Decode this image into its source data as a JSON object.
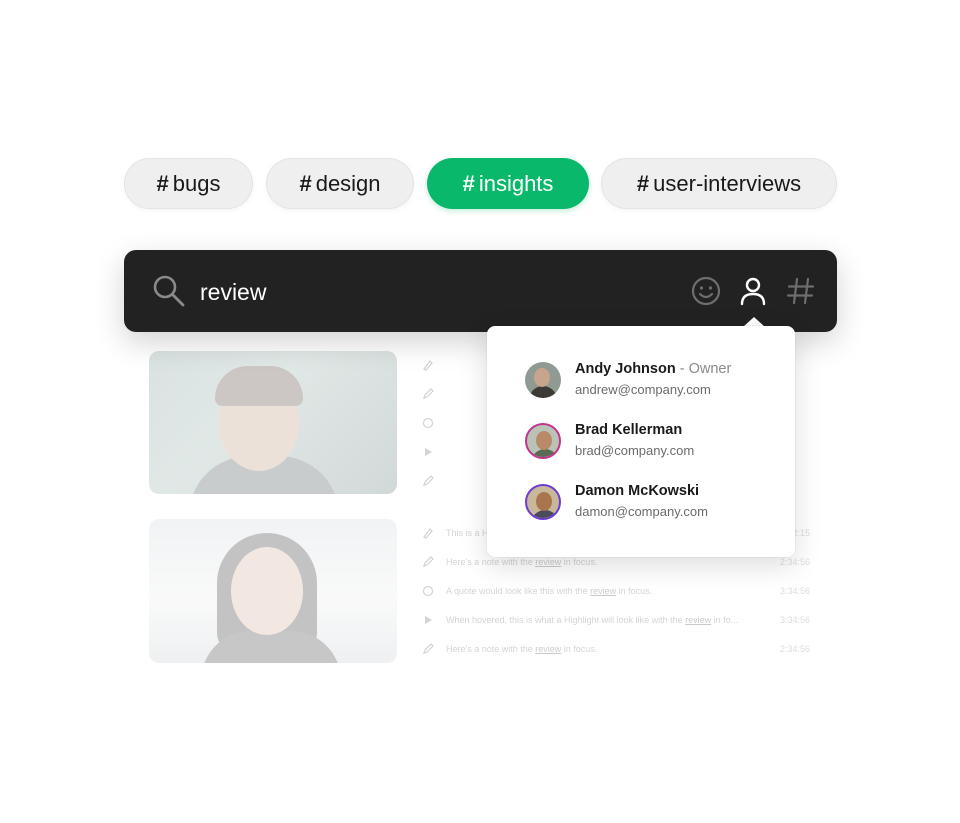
{
  "tags": [
    {
      "prefix": "#",
      "label": "bugs",
      "active": false
    },
    {
      "prefix": "#",
      "label": "design",
      "active": false
    },
    {
      "prefix": "#",
      "label": "insights",
      "active": true
    },
    {
      "prefix": "#",
      "label": "user-interviews",
      "active": false
    }
  ],
  "search": {
    "value": "review",
    "icons": [
      "search-icon",
      "emoji-icon",
      "person-icon",
      "hashtag-icon"
    ]
  },
  "dropdown": {
    "users": [
      {
        "name": "Andy Johnson",
        "role": " - Owner",
        "email": "andrew@company.com"
      },
      {
        "name": "Brad Kellerman",
        "role": "",
        "email": "brad@company.com"
      },
      {
        "name": "Damon McKowski",
        "role": "",
        "email": "damon@company.com"
      }
    ]
  },
  "background_notes": {
    "group2": [
      {
        "pre": "This is a Highlight",
        "word": "",
        "post": "",
        "time": "2:15"
      },
      {
        "pre": "Here's a note with the ",
        "word": "review",
        "post": " in focus.",
        "time": "2:34:56"
      },
      {
        "pre": "A quote would look like this with the ",
        "word": "review",
        "post": " in focus.",
        "time": "3:34:56"
      },
      {
        "pre": "When hovered, this is what a Highlight will look like with the ",
        "word": "review",
        "post": " in fo...",
        "time": "3:34:56"
      },
      {
        "pre": "Here's a note with the ",
        "word": "review",
        "post": " in focus.",
        "time": "2:34:56"
      }
    ]
  },
  "colors": {
    "accent": "#0ab86b",
    "search_bar": "#222222",
    "chip": "#efefef"
  }
}
